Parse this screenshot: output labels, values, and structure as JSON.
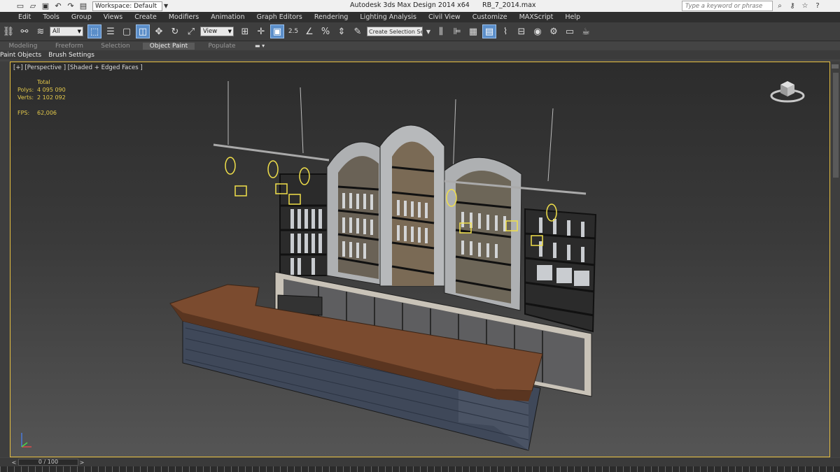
{
  "titlebar": {
    "workspace": "Workspace: Default",
    "app_title": "Autodesk 3ds Max Design 2014 x64",
    "file_name": "RB_7_2014.max",
    "search_placeholder": "Type a keyword or phrase"
  },
  "menu": [
    "Edit",
    "Tools",
    "Group",
    "Views",
    "Create",
    "Modifiers",
    "Animation",
    "Graph Editors",
    "Rendering",
    "Lighting Analysis",
    "Civil View",
    "Customize",
    "MAXScript",
    "Help"
  ],
  "toolbar": {
    "selection_filter": "All",
    "ref_coord": "View",
    "named_selection": "Create Selection Se",
    "snap_label": "2.5"
  },
  "ribbon": {
    "tabs": [
      "Modeling",
      "Freeform",
      "Selection",
      "Object Paint",
      "Populate"
    ],
    "active_tab": "Object Paint",
    "subtabs": [
      "Paint Objects",
      "Brush Settings"
    ]
  },
  "viewport": {
    "label": "[+] [Perspective ] [Shaded + Edged Faces ]",
    "stats": {
      "total_label": "Total",
      "polys_label": "Polys:",
      "polys": "4 095 090",
      "verts_label": "Verts:",
      "verts": "2 102 092",
      "fps_label": "FPS:",
      "fps": "62,006"
    }
  },
  "timeslider": {
    "frame": "0 / 100"
  },
  "colors": {
    "viewport_border": "#e8c040",
    "active_blue": "#5b8ec9",
    "light_yellow": "#f1e04a",
    "wood": "#7a4a30",
    "brick": "#4b5567"
  }
}
